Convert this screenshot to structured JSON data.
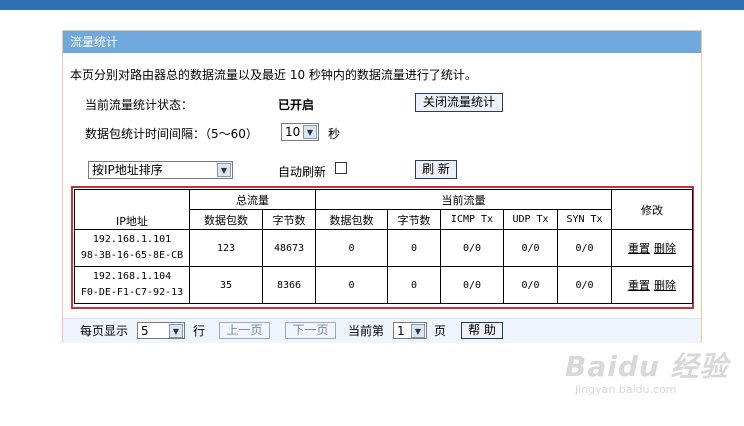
{
  "panel": {
    "title": "流量统计",
    "description": "本页分别对路由器总的数据流量以及最近 10 秒钟内的数据流量进行了统计。",
    "status_label": "当前流量统计状态：",
    "status_value": "已开启",
    "toggle_button": "关闭流量统计",
    "interval_label": "数据包统计时间间隔：（5～60）",
    "interval_value": "10",
    "interval_unit": "秒",
    "sort_value": "按IP地址排序",
    "auto_refresh_label": "自动刷新",
    "refresh_button": "刷 新"
  },
  "table": {
    "group_total": "总流量",
    "group_current": "当前流量",
    "col_ip": "IP地址",
    "col_modify": "修改",
    "sub_columns": [
      "数据包数",
      "字节数",
      "数据包数",
      "字节数",
      "ICMP Tx",
      "UDP Tx",
      "SYN Tx"
    ],
    "rows": [
      {
        "ip": "192.168.1.101",
        "mac": "98-3B-16-65-8E-CB",
        "packets": "123",
        "bytes": "48673",
        "cur_packets": "0",
        "cur_bytes": "0",
        "icmp": "0/0",
        "udp": "0/0",
        "syn": "0/0",
        "reset": "重置",
        "delete": "删除"
      },
      {
        "ip": "192.168.1.104",
        "mac": "F0-DE-F1-C7-92-13",
        "packets": "35",
        "bytes": "8366",
        "cur_packets": "0",
        "cur_bytes": "0",
        "icmp": "0/0",
        "udp": "0/0",
        "syn": "0/0",
        "reset": "重置",
        "delete": "删除"
      }
    ]
  },
  "pager": {
    "per_page_label": "每页显示",
    "per_page_value": "5",
    "row_unit": "行",
    "prev_button": "上一页",
    "next_button": "下一页",
    "current_label": "当前第",
    "current_page": "1",
    "page_unit": "页",
    "help_button": "帮 助"
  },
  "watermark": {
    "logo": "Baidu 经验",
    "url": "jingyan.baidu.com"
  },
  "colors": {
    "title_bar": "#6fa8dc",
    "top_bar": "#2f6fb2",
    "highlight_border": "#c8323c"
  }
}
